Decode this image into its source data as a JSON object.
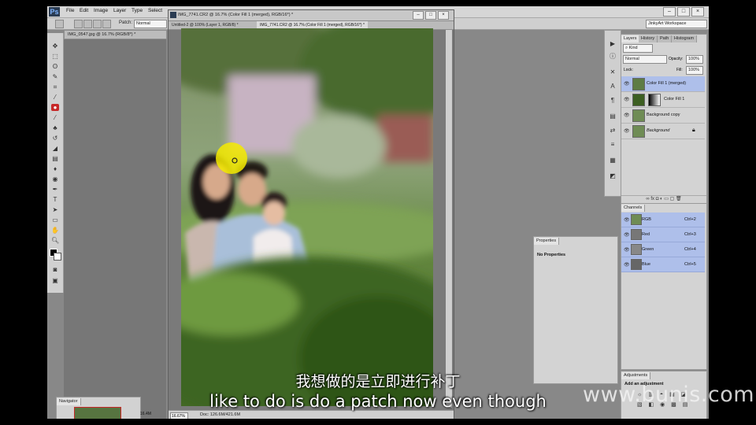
{
  "app": {
    "logo": "Ps",
    "menu": [
      "File",
      "Edit",
      "Image",
      "Layer",
      "Type",
      "Select"
    ],
    "workspace": "JinkyArt Workspace",
    "window_controls": [
      "–",
      "□",
      "×"
    ]
  },
  "options_bar": {
    "patch_label": "Patch:",
    "patch_mode": "Normal"
  },
  "documents": {
    "back_tab": "IMG_0547.jpg @ 16.7% (RGB/8*) *",
    "tab_untitled": "Untitled-2 @ 100% (Layer 1, RGB/8) *",
    "tab_img": "IMG_7741.CR2 @ 16.7% (Color Fill 1 (merged), RGB/16*) *",
    "active_title": "IMG_7741.CR2 @ 16.7% (Color Fill 1 (merged), RGB/16*) *",
    "active_controls": [
      "–",
      "□",
      "×"
    ],
    "zoom": "16.67%",
    "doc_size": "Doc: 126.6M/421.6M"
  },
  "layers_panel": {
    "tabs": [
      "Layers",
      "History",
      "Path",
      "Histogram"
    ],
    "kind": "Kind",
    "blend_mode": "Normal",
    "opacity_label": "Opacity:",
    "opacity": "100%",
    "lock_label": "Lock:",
    "fill_label": "Fill:",
    "fill": "100%",
    "layers": [
      {
        "name": "Color Fill 1 (merged)",
        "selected": true
      },
      {
        "name": "Color Fill 1",
        "selected": false
      },
      {
        "name": "Background copy",
        "selected": false
      },
      {
        "name": "Background",
        "selected": false
      }
    ],
    "footer_icons": [
      "link-icon",
      "fx-icon",
      "mask-icon",
      "adjustment-icon",
      "folder-icon",
      "new-layer-icon",
      "trash-icon"
    ]
  },
  "channels_panel": {
    "title": "Channels",
    "channels": [
      {
        "name": "RGB",
        "shortcut": "Ctrl+2"
      },
      {
        "name": "Red",
        "shortcut": "Ctrl+3"
      },
      {
        "name": "Green",
        "shortcut": "Ctrl+4"
      },
      {
        "name": "Blue",
        "shortcut": "Ctrl+5"
      }
    ]
  },
  "properties_panel": {
    "title": "Properties",
    "content": "No Properties"
  },
  "adjustments_panel": {
    "title": "Adjustments",
    "content": "Add an adjustment"
  },
  "navigator": {
    "title": "Navigator",
    "zoom_hint": "16.4M"
  },
  "subtitles": {
    "chinese": "我想做的是立即进行补丁",
    "english": "like to do is do a patch now even though"
  },
  "watermark": "www.bunis.com",
  "colors": {
    "selected_row": "#aebfea",
    "cursor_highlight": "#f5ea00"
  }
}
